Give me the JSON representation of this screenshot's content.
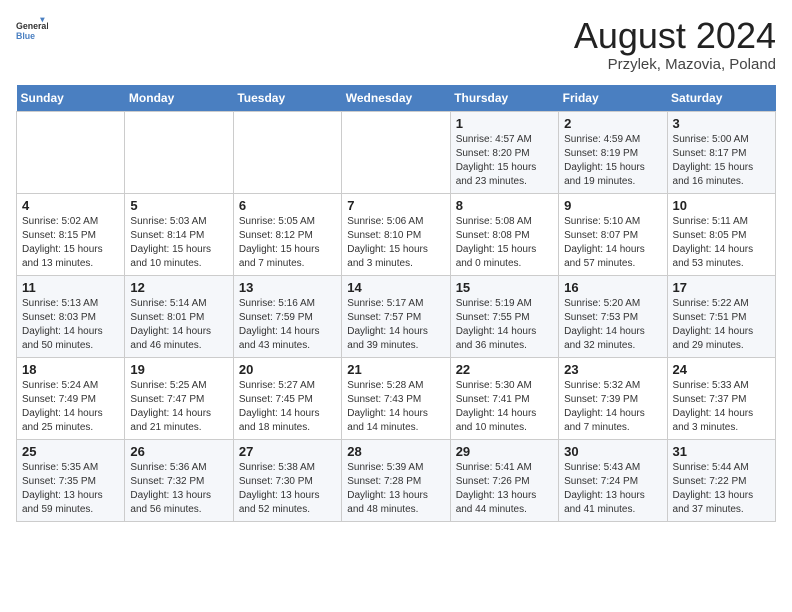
{
  "header": {
    "title": "August 2024",
    "subtitle": "Przylek, Mazovia, Poland",
    "logo_general": "General",
    "logo_blue": "Blue"
  },
  "weekdays": [
    "Sunday",
    "Monday",
    "Tuesday",
    "Wednesday",
    "Thursday",
    "Friday",
    "Saturday"
  ],
  "weeks": [
    [
      {
        "day": "",
        "info": ""
      },
      {
        "day": "",
        "info": ""
      },
      {
        "day": "",
        "info": ""
      },
      {
        "day": "",
        "info": ""
      },
      {
        "day": "1",
        "info": "Sunrise: 4:57 AM\nSunset: 8:20 PM\nDaylight: 15 hours\nand 23 minutes."
      },
      {
        "day": "2",
        "info": "Sunrise: 4:59 AM\nSunset: 8:19 PM\nDaylight: 15 hours\nand 19 minutes."
      },
      {
        "day": "3",
        "info": "Sunrise: 5:00 AM\nSunset: 8:17 PM\nDaylight: 15 hours\nand 16 minutes."
      }
    ],
    [
      {
        "day": "4",
        "info": "Sunrise: 5:02 AM\nSunset: 8:15 PM\nDaylight: 15 hours\nand 13 minutes."
      },
      {
        "day": "5",
        "info": "Sunrise: 5:03 AM\nSunset: 8:14 PM\nDaylight: 15 hours\nand 10 minutes."
      },
      {
        "day": "6",
        "info": "Sunrise: 5:05 AM\nSunset: 8:12 PM\nDaylight: 15 hours\nand 7 minutes."
      },
      {
        "day": "7",
        "info": "Sunrise: 5:06 AM\nSunset: 8:10 PM\nDaylight: 15 hours\nand 3 minutes."
      },
      {
        "day": "8",
        "info": "Sunrise: 5:08 AM\nSunset: 8:08 PM\nDaylight: 15 hours\nand 0 minutes."
      },
      {
        "day": "9",
        "info": "Sunrise: 5:10 AM\nSunset: 8:07 PM\nDaylight: 14 hours\nand 57 minutes."
      },
      {
        "day": "10",
        "info": "Sunrise: 5:11 AM\nSunset: 8:05 PM\nDaylight: 14 hours\nand 53 minutes."
      }
    ],
    [
      {
        "day": "11",
        "info": "Sunrise: 5:13 AM\nSunset: 8:03 PM\nDaylight: 14 hours\nand 50 minutes."
      },
      {
        "day": "12",
        "info": "Sunrise: 5:14 AM\nSunset: 8:01 PM\nDaylight: 14 hours\nand 46 minutes."
      },
      {
        "day": "13",
        "info": "Sunrise: 5:16 AM\nSunset: 7:59 PM\nDaylight: 14 hours\nand 43 minutes."
      },
      {
        "day": "14",
        "info": "Sunrise: 5:17 AM\nSunset: 7:57 PM\nDaylight: 14 hours\nand 39 minutes."
      },
      {
        "day": "15",
        "info": "Sunrise: 5:19 AM\nSunset: 7:55 PM\nDaylight: 14 hours\nand 36 minutes."
      },
      {
        "day": "16",
        "info": "Sunrise: 5:20 AM\nSunset: 7:53 PM\nDaylight: 14 hours\nand 32 minutes."
      },
      {
        "day": "17",
        "info": "Sunrise: 5:22 AM\nSunset: 7:51 PM\nDaylight: 14 hours\nand 29 minutes."
      }
    ],
    [
      {
        "day": "18",
        "info": "Sunrise: 5:24 AM\nSunset: 7:49 PM\nDaylight: 14 hours\nand 25 minutes."
      },
      {
        "day": "19",
        "info": "Sunrise: 5:25 AM\nSunset: 7:47 PM\nDaylight: 14 hours\nand 21 minutes."
      },
      {
        "day": "20",
        "info": "Sunrise: 5:27 AM\nSunset: 7:45 PM\nDaylight: 14 hours\nand 18 minutes."
      },
      {
        "day": "21",
        "info": "Sunrise: 5:28 AM\nSunset: 7:43 PM\nDaylight: 14 hours\nand 14 minutes."
      },
      {
        "day": "22",
        "info": "Sunrise: 5:30 AM\nSunset: 7:41 PM\nDaylight: 14 hours\nand 10 minutes."
      },
      {
        "day": "23",
        "info": "Sunrise: 5:32 AM\nSunset: 7:39 PM\nDaylight: 14 hours\nand 7 minutes."
      },
      {
        "day": "24",
        "info": "Sunrise: 5:33 AM\nSunset: 7:37 PM\nDaylight: 14 hours\nand 3 minutes."
      }
    ],
    [
      {
        "day": "25",
        "info": "Sunrise: 5:35 AM\nSunset: 7:35 PM\nDaylight: 13 hours\nand 59 minutes."
      },
      {
        "day": "26",
        "info": "Sunrise: 5:36 AM\nSunset: 7:32 PM\nDaylight: 13 hours\nand 56 minutes."
      },
      {
        "day": "27",
        "info": "Sunrise: 5:38 AM\nSunset: 7:30 PM\nDaylight: 13 hours\nand 52 minutes."
      },
      {
        "day": "28",
        "info": "Sunrise: 5:39 AM\nSunset: 7:28 PM\nDaylight: 13 hours\nand 48 minutes."
      },
      {
        "day": "29",
        "info": "Sunrise: 5:41 AM\nSunset: 7:26 PM\nDaylight: 13 hours\nand 44 minutes."
      },
      {
        "day": "30",
        "info": "Sunrise: 5:43 AM\nSunset: 7:24 PM\nDaylight: 13 hours\nand 41 minutes."
      },
      {
        "day": "31",
        "info": "Sunrise: 5:44 AM\nSunset: 7:22 PM\nDaylight: 13 hours\nand 37 minutes."
      }
    ]
  ]
}
